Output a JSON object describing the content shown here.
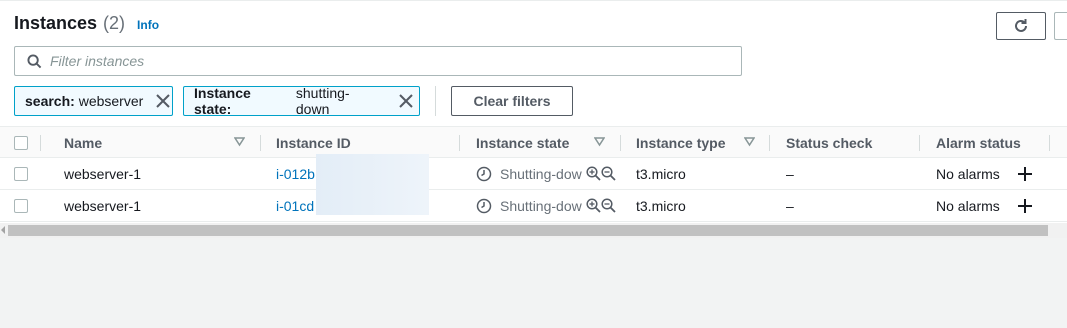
{
  "header": {
    "title": "Instances",
    "count": "(2)",
    "info_link": "Info"
  },
  "search": {
    "placeholder": "Filter instances"
  },
  "filters": [
    {
      "key": "search:",
      "value": "webserver"
    },
    {
      "key": "Instance state:",
      "value": "shutting-down"
    }
  ],
  "clear_filters_label": "Clear filters",
  "columns": [
    "Name",
    "Instance ID",
    "Instance state",
    "Instance type",
    "Status check",
    "Alarm status"
  ],
  "rows": [
    {
      "name": "webserver-1",
      "instance_id": "i-012b",
      "state": "Shutting-dow",
      "type": "t3.micro",
      "status_check": "–",
      "alarm": "No alarms"
    },
    {
      "name": "webserver-1",
      "instance_id": "i-01cd",
      "state": "Shutting-dow",
      "type": "t3.micro",
      "status_check": "–",
      "alarm": "No alarms"
    }
  ],
  "icons": {
    "refresh": "refresh-icon",
    "search": "search-icon",
    "remove_filter": "close-icon",
    "sort": "sort-caret-icon",
    "state": "clock-icon",
    "zoom_in": "zoom-in-icon",
    "zoom_out": "zoom-out-icon",
    "add_alarm": "plus-icon"
  },
  "colors": {
    "link": "#0073bb",
    "token_border": "#00a1c9",
    "token_bg": "#f1faff",
    "page_bg": "#f2f3f3"
  }
}
